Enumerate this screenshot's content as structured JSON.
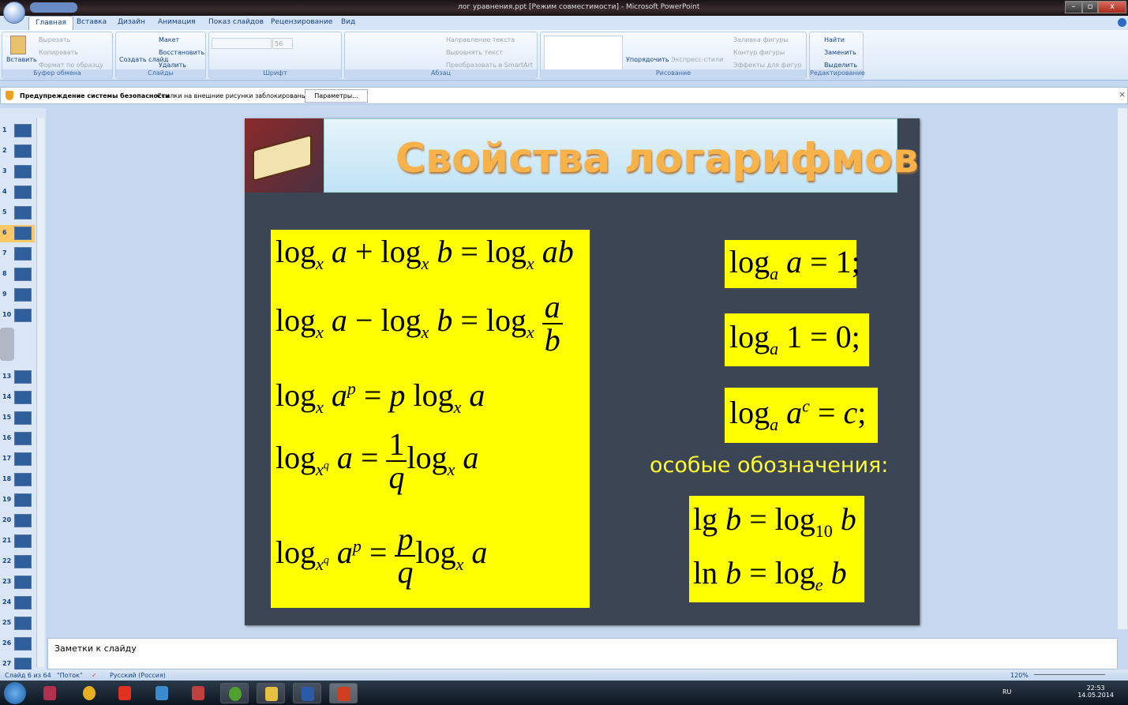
{
  "window": {
    "title": "лог уравнения.ppt [Режим совместимости] - Microsoft PowerPoint",
    "minimize": "–",
    "maximize": "▫",
    "close": "x"
  },
  "tabs": [
    "Главная",
    "Вставка",
    "Дизайн",
    "Анимация",
    "Показ слайдов",
    "Рецензирование",
    "Вид"
  ],
  "ribbon": {
    "clipboard": {
      "label": "Буфер обмена",
      "paste": "Вставить",
      "cut": "Вырезать",
      "copy": "Копировать",
      "format": "Формат по образцу"
    },
    "slides": {
      "label": "Слайды",
      "new": "Создать слайд",
      "layout": "Макет",
      "reset": "Восстановить",
      "delete": "Удалить"
    },
    "font": {
      "label": "Шрифт",
      "size": "56"
    },
    "paragraph": {
      "label": "Абзац",
      "direction": "Направление текста",
      "align": "Выровнять текст",
      "smartart": "Преобразовать в SmartArt"
    },
    "drawing": {
      "label": "Рисование",
      "arrange": "Упорядочить",
      "styles": "Экспресс-стили",
      "fill": "Заливка фигуры",
      "outline": "Контур фигуры",
      "effects": "Эффекты для фигур"
    },
    "editing": {
      "label": "Редактирование",
      "find": "Найти",
      "replace": "Заменить",
      "select": "Выделить"
    }
  },
  "security": {
    "title": "Предупреждение системы безопасности",
    "message": "Ссылки на внешние рисунки заблокированы",
    "button": "Параметры..."
  },
  "thumbnails": [
    "1",
    "2",
    "3",
    "4",
    "5",
    "6",
    "7",
    "8",
    "9",
    "10",
    "13",
    "14",
    "15",
    "16",
    "17",
    "18",
    "19",
    "20",
    "21",
    "22",
    "23",
    "24",
    "25",
    "26",
    "27"
  ],
  "selected_slide": "6",
  "slide": {
    "title": "Свойства логарифмов",
    "special_label": "особые обозначения:",
    "formulas_left": [
      "log_x a + log_x b = log_x ab",
      "log_x a − log_x b = log_x (a/b)",
      "log_x a^p = p log_x a",
      "log_{x^q} a = (1/q) log_x a",
      "log_{x^q} a^p = (p/q) log_x a"
    ],
    "formulas_right": [
      "log_a a = 1;",
      "log_a 1 = 0;",
      "log_a a^c = c;"
    ],
    "special": [
      "lg b = log_10 b",
      "ln b = log_e b"
    ]
  },
  "notes": {
    "placeholder": "Заметки к слайду"
  },
  "status": {
    "slide": "Слайд 6 из 64",
    "theme": "\"Поток\"",
    "language": "Русский (Россия)",
    "zoom": "120%"
  },
  "taskbar": {
    "lang": "RU",
    "time": "22:53",
    "date": "14.05.2014"
  },
  "colors": {
    "formula_bg": "#ffff00",
    "title": "#f7b24a",
    "slide_bg": "#3c4553"
  }
}
